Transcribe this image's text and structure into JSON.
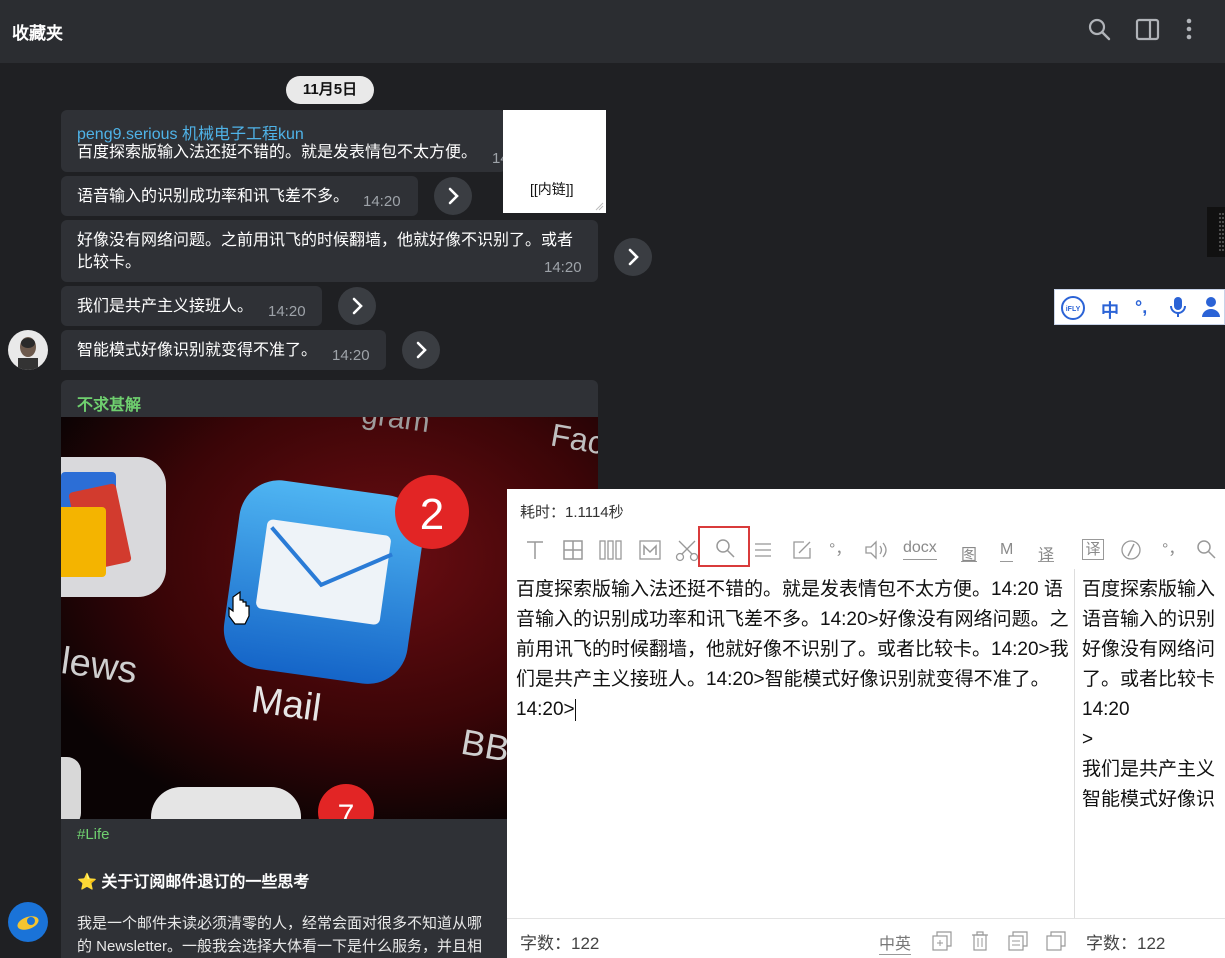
{
  "app": {
    "title": "收藏夹"
  },
  "chat": {
    "date": "11月5日",
    "messages": [
      {
        "sender": "peng9.serious 机械电子工程kun",
        "text": "百度探索版输入法还挺不错的。就是发表情包不太方便。",
        "time": "14"
      },
      {
        "text": "语音输入的识别成功率和讯飞差不多。",
        "time": "14:20"
      },
      {
        "text_line1": "好像没有网络问题。之前用讯飞的时候翻墙，他就好像不识别了。或者",
        "text_line2": "比较卡。",
        "time": "14:20"
      },
      {
        "text": "我们是共产主义接班人。",
        "time": "14:20"
      },
      {
        "text": "智能模式好像识别就变得不准了。",
        "time": "14:20"
      }
    ],
    "thumbnail_label": "[[内链]]",
    "card": {
      "header": "不求甚解",
      "tag": "#Life",
      "title": "⭐ 关于订阅邮件退订的一些思考",
      "body_line1": "我是一个邮件未读必须清零的人，经常会面对很多不知道从哪",
      "body_line2": "的 Newsletter。一般我会选择大体看一下是什么服务，并且相",
      "image_texts": {
        "app": "Mail",
        "news": "lews",
        "badge": "2",
        "bb": "BB",
        "fa": "Fac",
        "gram": "gram",
        "badge2": "7"
      }
    }
  },
  "ifly_toolbar": {
    "logo": "iFLY",
    "lang": "中",
    "punct": "°,"
  },
  "ocr_panel": {
    "elapsed": "耗时：1.1114秒",
    "tools": [
      "docx",
      "图",
      "M",
      "译",
      "译"
    ],
    "punct_label": "°，",
    "text_a": "百度探索版输入法还挺不错的。就是发表情包不太方便。14:20 语音输入的识别成功率和讯飞差不多。14:20>好像没有网络问题。之前用讯飞的时候翻墙，他就好像不识别了。或者比较卡。14:20>我们是共产主义接班人。14:20>智能模式好像识别就变得不准了。14:20>",
    "text_b_lines": [
      "百度探索版输入",
      "语音输入的识别",
      "好像没有网络问",
      "了。或者比较卡",
      "14:20",
      ">",
      "我们是共产主义",
      "智能模式好像识"
    ],
    "footer": {
      "count_left": "字数：122",
      "lang_toggle": "中英",
      "count_right": "字数：122"
    }
  }
}
